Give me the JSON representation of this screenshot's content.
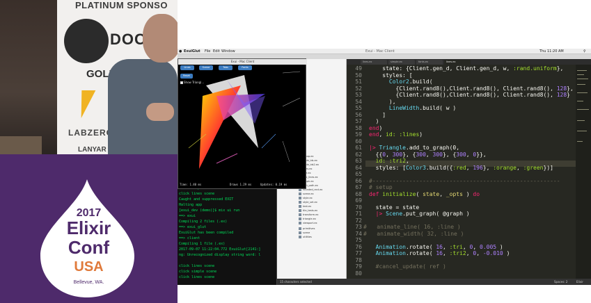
{
  "conference": {
    "sponsor_heading": "PLATINUM SPONSO",
    "sponsor_docker": "DOCK",
    "sponsor_gold": "GOLD",
    "sponsor_labzero": "LABZERO",
    "lanyard": "LANYAR",
    "year": "2017",
    "name_line1": "Elixir",
    "name_line2": "Conf",
    "country": "USA",
    "city": "Bellevue, WA."
  },
  "menubar": {
    "app": "ExuiGlut",
    "items": [
      "File",
      "Edit",
      "Window"
    ],
    "window_title": "Exui - Mac Client",
    "clock": "Thu 11:20 AM"
  },
  "app_window": {
    "buttons": [
      "Lines",
      "Scene",
      "Tabs",
      "Fonts",
      "Reset"
    ],
    "show_triangles": "Show Triangl...",
    "frame_time": "Time: 1.40 ms",
    "draws_time": "Draws 1.29 ms",
    "updates_time": "Updates: 0.19 ms"
  },
  "terminal": {
    "lines": [
      "click simple scene",
      "click lines scene",
      "Caught and suppressed EXIT",
      "Halting app",
      "[exui_dev (demo)]$ mix ui run",
      "==> exui",
      "Compiling 2 files (.ex)",
      "==> exui_glut",
      "ExuiGlut has been compiled",
      "==> client",
      "Compiling 1 file (.ex)",
      "2017-09-07 11:22:04.772 ExuiGlut[2141:]",
      "ng: Unrecognized display string word: l",
      "",
      "click lines scene",
      "click simple scene",
      "click lines scene"
    ]
  },
  "filetree": {
    "items": [
      "group.ex",
      "node_ids.ex",
      "node_ids2.ex",
      "lines.ex",
      "line.ex",
      "mix_lines.ex",
      "graph.ex",
      "rect_path.ex",
      "rounded_rect.ex",
      "scene.ex",
      "style.ex",
      "style_set.ex",
      "text.ex",
      "tile_tests.ex",
      "transform.ex",
      "triangle.ex",
      "viewport.ex",
      "primitives",
      "scene",
      "utilities"
    ]
  },
  "editor": {
    "tabs": [
      "lines.ex",
      "simple.ex",
      "fonts.ex",
      "lines.ex"
    ],
    "line_numbers": [
      "49",
      "50",
      "51",
      "52",
      "53",
      "54",
      "55",
      "56",
      "57",
      "58",
      "59",
      "60",
      "61",
      "62",
      "63",
      "64",
      "65",
      "66",
      "67",
      "68",
      "69",
      "70",
      "71",
      "72",
      "73",
      "74",
      "75",
      "76",
      "77",
      "78",
      "79",
      "80"
    ],
    "status_left": "15 characters selected",
    "status_spaces": "Spaces: 2",
    "status_lang": "Elixir"
  }
}
